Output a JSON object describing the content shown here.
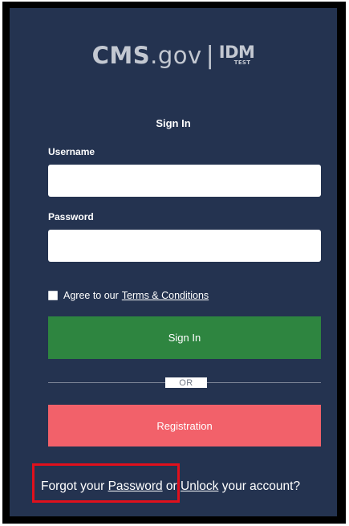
{
  "logo": {
    "main_bold": "CMS",
    "main_light": ".gov",
    "separator": "|",
    "idm": "IDM",
    "test": "TEST"
  },
  "form": {
    "title": "Sign In",
    "username_label": "Username",
    "username_value": "",
    "password_label": "Password",
    "password_value": "",
    "agree_text": "Agree to our",
    "terms_link": "Terms & Conditions",
    "agree_checked": false
  },
  "buttons": {
    "signin": "Sign In",
    "or": "OR",
    "registration": "Registration"
  },
  "footer": {
    "forgot_prefix": "Forgot your ",
    "password_link": "Password",
    "or_text": " or ",
    "unlock_link": "Unlock",
    "suffix": " your account?"
  },
  "colors": {
    "background": "#243350",
    "signin_button": "#2e8540",
    "registration_button": "#f2616a",
    "highlight": "#e0101c"
  }
}
